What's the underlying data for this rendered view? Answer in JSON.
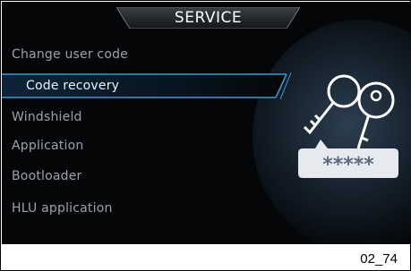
{
  "header": {
    "title": "SERVICE"
  },
  "menu": {
    "items": [
      {
        "label": "Change user code",
        "selected": false
      },
      {
        "label": "Code recovery",
        "selected": true
      },
      {
        "label": "Windshield",
        "selected": false
      },
      {
        "label": "Application",
        "selected": false
      },
      {
        "label": "Bootloader",
        "selected": false
      },
      {
        "label": "HLU application",
        "selected": false
      }
    ]
  },
  "graphic": {
    "name": "key-password-icon",
    "masked_code": "*****"
  },
  "footer": {
    "figure_id": "02_74"
  },
  "colors": {
    "background": "#050608",
    "accent": "#3a9bd5",
    "text": "#9da2a8",
    "selected_text": "#e9f3ff"
  }
}
